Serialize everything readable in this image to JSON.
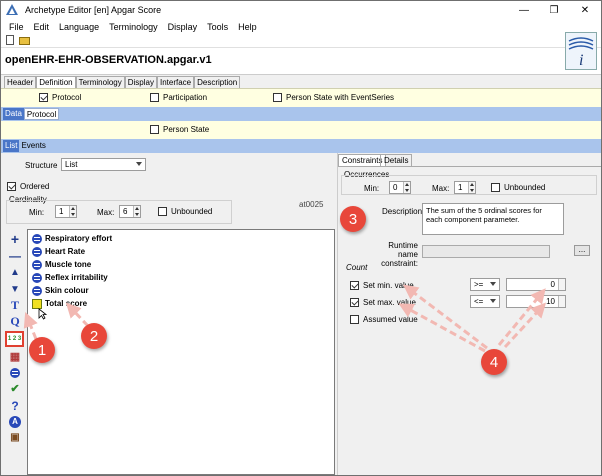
{
  "window": {
    "title": "Archetype Editor [en] Apgar Score",
    "controls": [
      "—",
      "❐",
      "✕"
    ]
  },
  "menu": [
    "File",
    "Edit",
    "Language",
    "Terminology",
    "Display",
    "Tools",
    "Help"
  ],
  "archetype_id": "openEHR-EHR-OBSERVATION.apgar.v1",
  "main_tabs": [
    "Header",
    "Definition",
    "Terminology",
    "Display",
    "Interface",
    "Description"
  ],
  "protocol_bar": {
    "protocol": "Protocol",
    "participation": "Participation",
    "person_state": "Person State with EventSeries"
  },
  "data_tabs": [
    "Data",
    "Protocol"
  ],
  "person_state": "Person State",
  "list_tabs": [
    "List",
    "Events"
  ],
  "left": {
    "structure_label": "Structure",
    "structure_value": "List",
    "ordered_label": "Ordered",
    "cardinality_label": "Cardinality",
    "min_label": "Min:",
    "min_value": "1",
    "max_label": "Max:",
    "max_value": "6",
    "unbounded_label": "Unbounded",
    "at_code": "at0025",
    "tree_items": [
      "Respiratory effort",
      "Heart Rate",
      "Muscle tone",
      "Reflex irritability",
      "Skin colour",
      "Total score"
    ],
    "tool_icons": [
      "+",
      "—",
      "▲",
      "▼",
      "T",
      "Q",
      "1 2 3",
      "▦",
      "☰",
      "✔",
      "?",
      "A",
      "▣"
    ]
  },
  "right": {
    "tabs": [
      "Constraints",
      "Details"
    ],
    "occurrences_label": "Occurrences",
    "min_label": "Min:",
    "min_value": "0",
    "max_label": "Max:",
    "max_value": "1",
    "unbounded_label": "Unbounded",
    "description_label": "Description",
    "description_value": "The sum of the 5 ordinal scores for each component parameter.",
    "runtime_label": "Runtime name constraint:",
    "runtime_btn": "...",
    "count_label": "Count",
    "set_min_label": "Set min. value",
    "set_min_op": ">=",
    "set_min_value": "0",
    "set_max_label": "Set max. value",
    "set_max_op": "<=",
    "set_max_value": "10",
    "assumed_label": "Assumed value"
  },
  "annotations": [
    "1",
    "2",
    "3",
    "4"
  ],
  "colors": {
    "accent_blue": "#4a76c8",
    "strip_blue": "#a9c4ec",
    "yellow_bg": "#ffffe1",
    "badge_red": "#e8473a"
  }
}
